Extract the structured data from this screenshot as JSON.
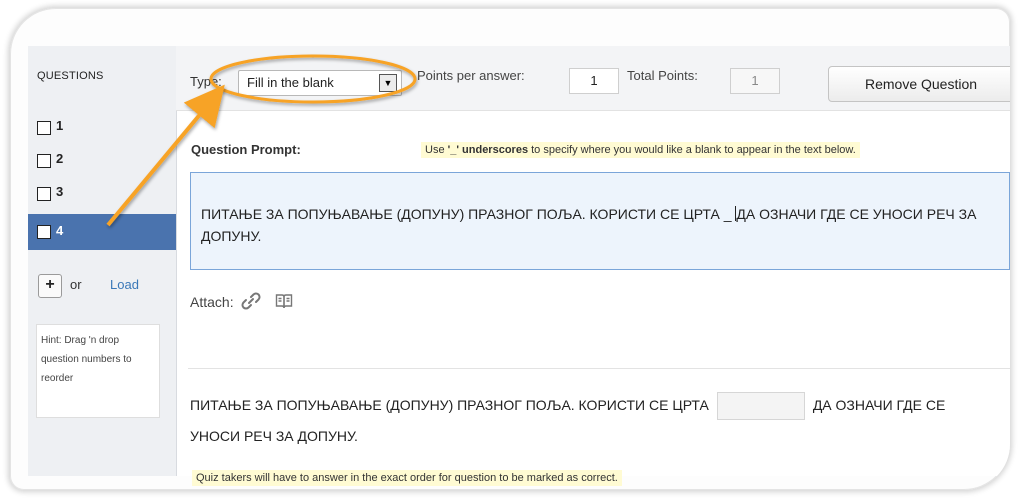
{
  "sidebar": {
    "title": "QUESTIONS",
    "items": [
      {
        "label": "1"
      },
      {
        "label": "2"
      },
      {
        "label": "3"
      },
      {
        "label": "4"
      }
    ],
    "active_index": 3,
    "add_label": "+",
    "or_label": "or",
    "load_label": "Load",
    "hint": "Hint: Drag 'n drop question numbers to reorder"
  },
  "toolbar": {
    "type_label": "Type:",
    "type_value": "Fill in the blank",
    "points_per_answer_label": "Points per answer:",
    "points_per_answer_value": "1",
    "total_points_label": "Total Points:",
    "total_points_value": "1",
    "remove_button": "Remove Question"
  },
  "prompt": {
    "label": "Question Prompt:",
    "hint_prefix": "Use ",
    "hint_bold": "'_' underscores",
    "hint_suffix": " to specify where you would like a blank to appear in the text below.",
    "text_before_cursor": "ПИТАЊЕ ЗА ПОПУЊАВАЊЕ (ДОПУНУ) ПРАЗНОГ ПОЉА. КОРИСТИ СЕ ЦРТА _ ",
    "text_after_cursor": "ДА ОЗНАЧИ ГДЕ СЕ УНОСИ РЕЧ ЗА ДОПУНУ."
  },
  "attach": {
    "label": "Attach:",
    "icons": [
      "link-icon",
      "book-icon"
    ]
  },
  "preview": {
    "text_before": "ПИТАЊЕ ЗА ПОПУЊАВАЊЕ (ДОПУНУ) ПРАЗНОГ ПОЉА. КОРИСТИ СЕ ЦРТА",
    "text_after": "ДА ОЗНАЧИ ГДЕ СЕ УНОСИ РЕЧ ЗА ДОПУНУ."
  },
  "footer_note": "Quiz takers will have to answer in the exact order for question to be marked as correct.",
  "colors": {
    "active_item": "#4a73ae",
    "annotation": "#f7a325",
    "hint_bg": "#fffbd3",
    "prompt_border": "#7aa5d9"
  }
}
